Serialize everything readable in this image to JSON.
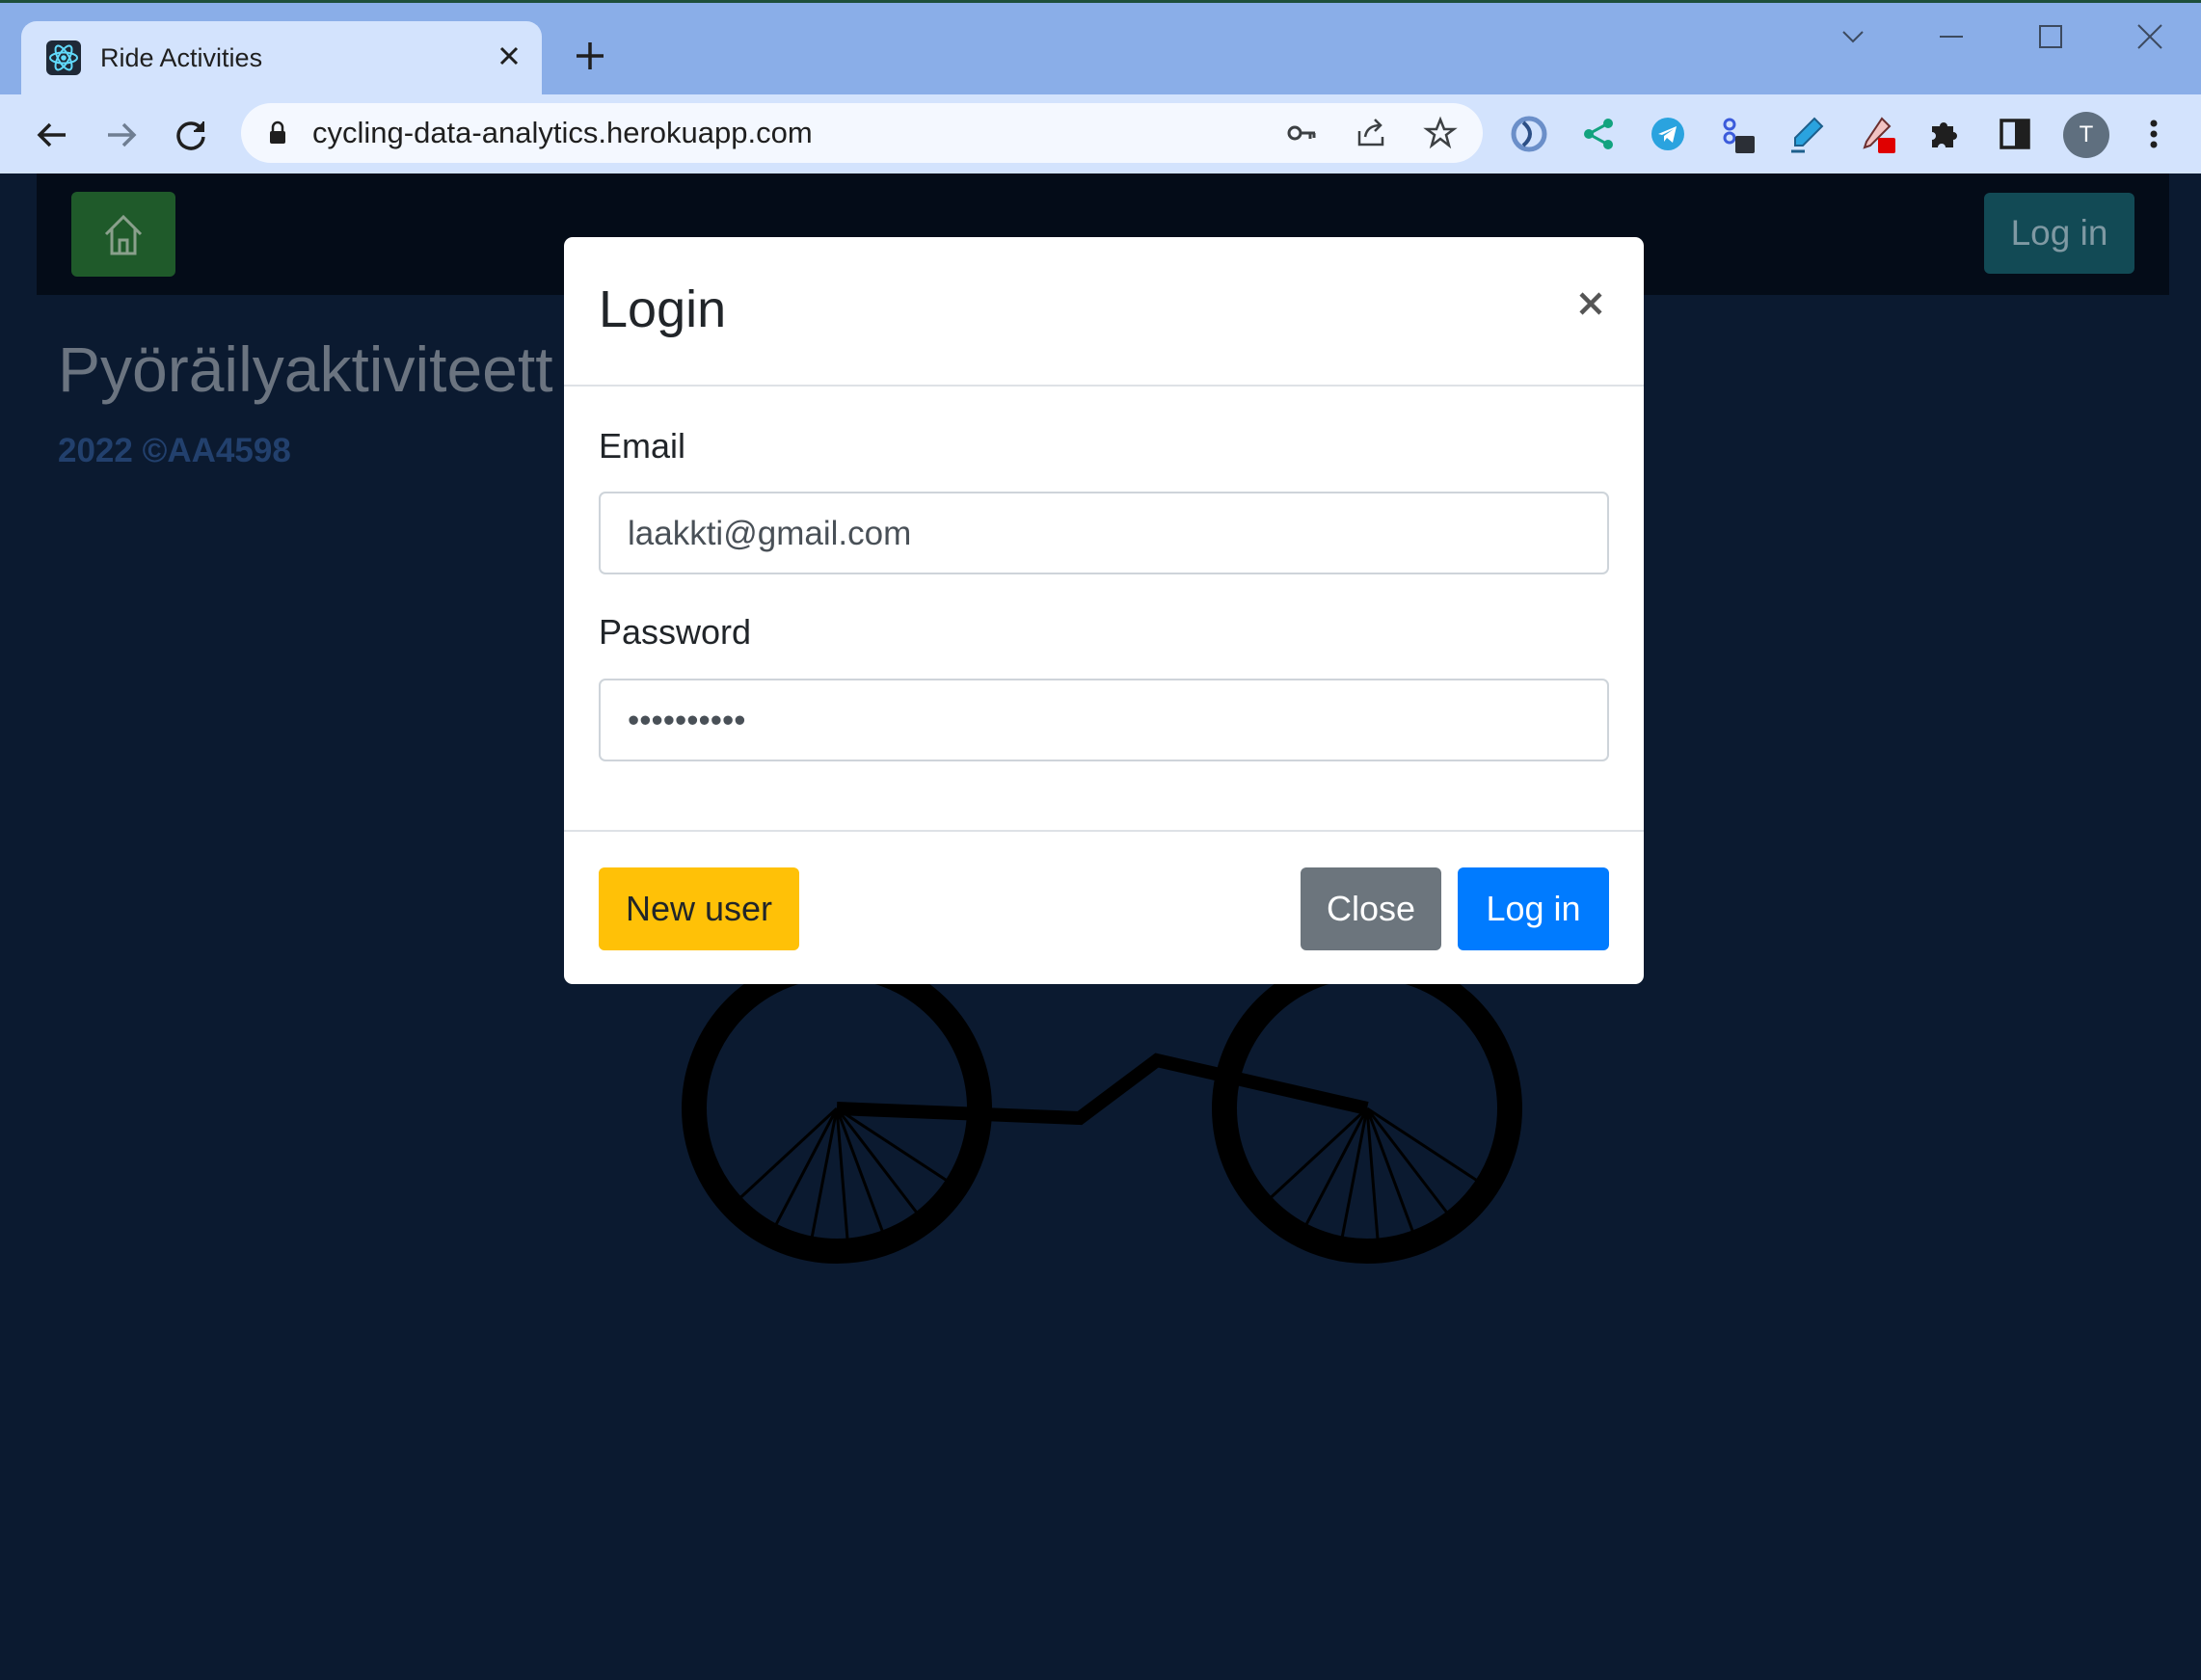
{
  "browser": {
    "tab_title": "Ride Activities",
    "url": "cycling-data-analytics.herokuapp.com",
    "profile_initial": "T"
  },
  "page": {
    "title": "Pyöräilyaktiviteett",
    "footer": "2022 ©AA4598",
    "nav_login_label": "Log in"
  },
  "modal": {
    "title": "Login",
    "email_label": "Email",
    "email_value": "laakkti@gmail.com",
    "password_label": "Password",
    "password_value": "••••••••••",
    "new_user_label": "New user",
    "close_label": "Close",
    "login_label": "Log in"
  },
  "colors": {
    "page_background": "#0b1a30",
    "warning": "#ffc107",
    "secondary": "#6c757d",
    "primary": "#007bff"
  }
}
